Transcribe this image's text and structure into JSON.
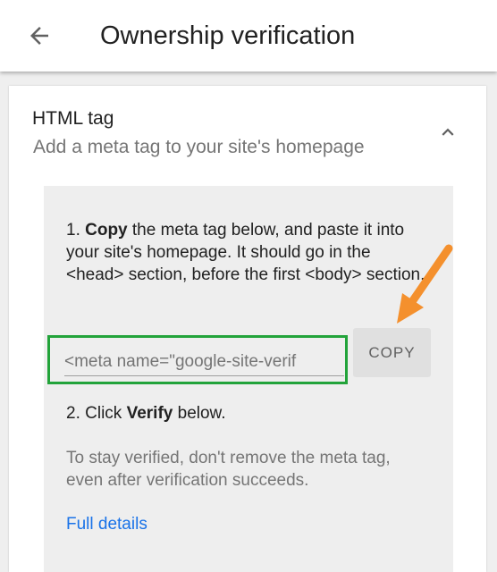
{
  "appbar": {
    "back_icon": "arrow-back-icon",
    "title": "Ownership verification"
  },
  "method": {
    "title": "HTML tag",
    "subtitle": "Add a meta tag to your site's homepage",
    "toggle_icon": "chevron-up-icon"
  },
  "instructions": {
    "step1_prefix": "1. ",
    "step1_bold": "Copy",
    "step1_rest": " the meta tag below, and paste it into your site's homepage. It should go in the <head> section, before the first <body> section.",
    "meta_tag_value": "<meta name=\"google-site-verification\" content=\"...\">",
    "meta_tag_visible": "<meta name=\"google-site-verif",
    "copy_label": "COPY",
    "step2_prefix": "2. Click ",
    "step2_bold": "Verify",
    "step2_rest": " below.",
    "note": "To stay verified, don't remove the meta tag, even after verification succeeds.",
    "details_link": "Full details"
  },
  "colors": {
    "highlight_border": "#22a33a",
    "annotation_arrow": "#f4902d",
    "link": "#1a73e8"
  }
}
